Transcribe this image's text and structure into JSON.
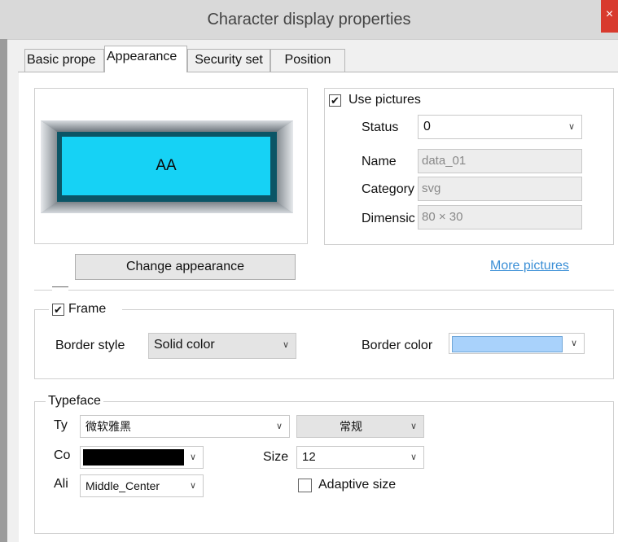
{
  "window": {
    "title": "Character display properties",
    "close_glyph": "×"
  },
  "tabs": [
    {
      "label": "Basic prope",
      "active": false
    },
    {
      "label": "Appearance",
      "active": true
    },
    {
      "label": "Security set",
      "active": false
    },
    {
      "label": "Position",
      "active": false
    }
  ],
  "preview": {
    "text": "AA",
    "fill_color": "#16d2f5",
    "inner_border_color": "#0b5566"
  },
  "appearance": {
    "change_button": "Change appearance",
    "more_pictures_link": "More pictures"
  },
  "use_pictures": {
    "label": "Use pictures",
    "checked": true,
    "status_label": "Status",
    "status_value": "0",
    "name_label": "Name",
    "name_value": "data_01",
    "category_label": "Category",
    "category_value": "svg",
    "dimension_label": "Dimensic",
    "dimension_value": "80 × 30"
  },
  "frame": {
    "label": "Frame",
    "checked": true,
    "border_style_label": "Border style",
    "border_style_value": "Solid color",
    "border_color_label": "Border color",
    "border_color_value": "#a9d2fb"
  },
  "typeface": {
    "legend": "Typeface",
    "type_label": "Ty",
    "type_value": "微软雅黑",
    "style_value": "常规",
    "color_label": "Co",
    "color_value": "#000000",
    "size_label": "Size",
    "size_value": "12",
    "align_label": "Ali",
    "align_value": "Middle_Center",
    "adaptive_label": "Adaptive size",
    "adaptive_checked": false
  },
  "icons": {
    "checkmark": "✔",
    "dropdown": "∨"
  }
}
